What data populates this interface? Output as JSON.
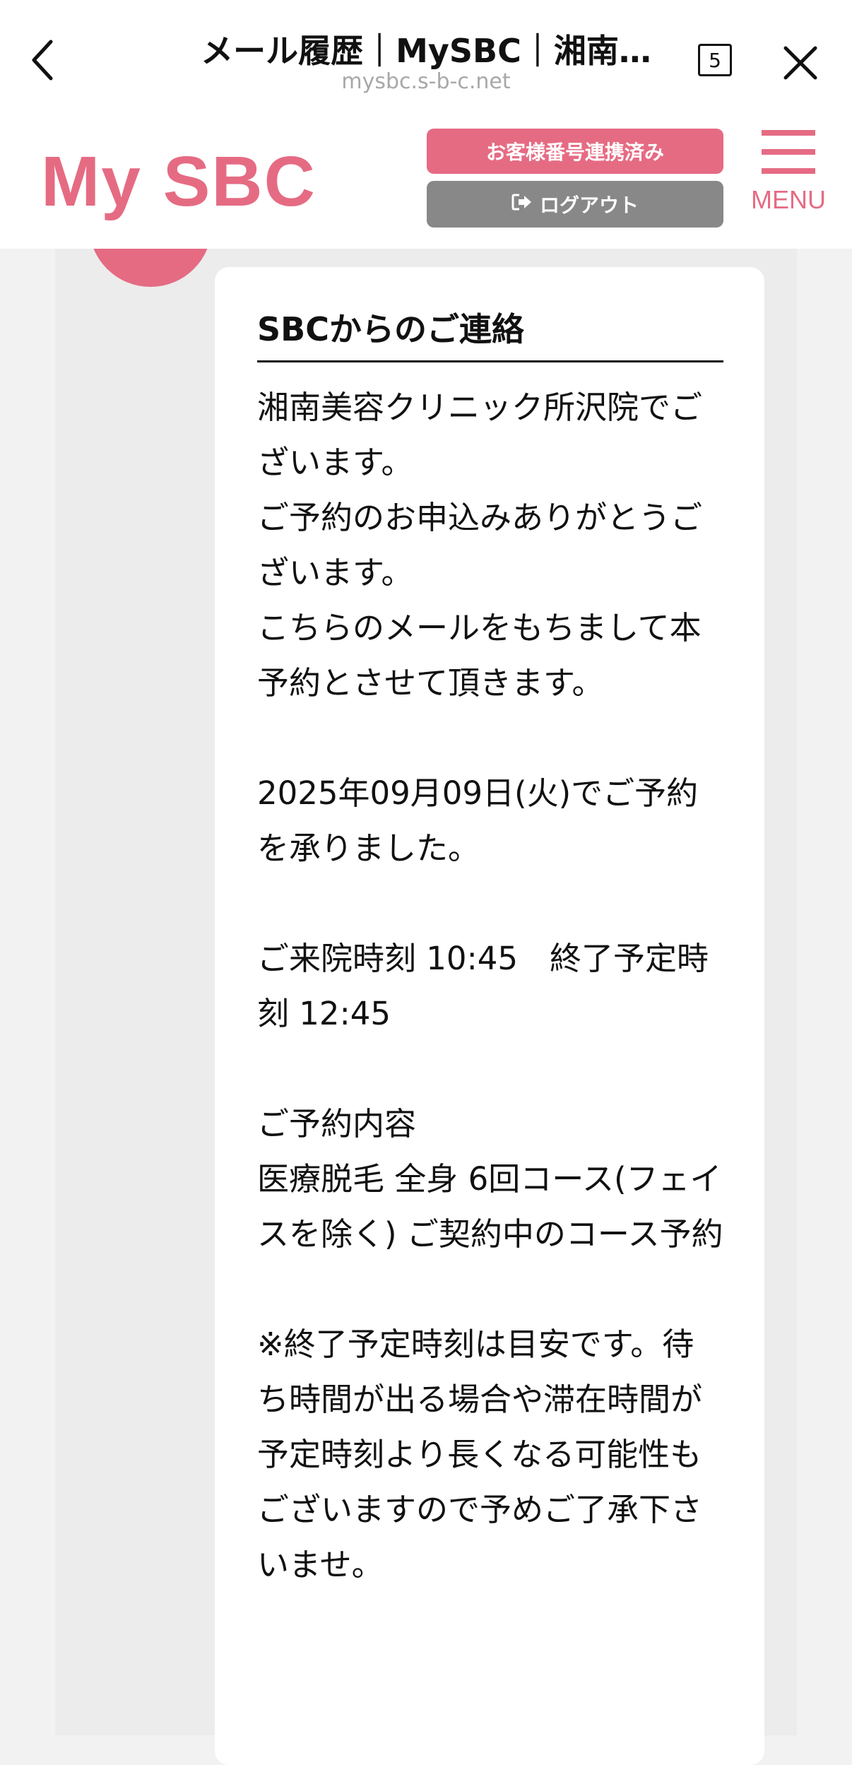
{
  "browser": {
    "title": "メール履歴｜MySBC｜湘南…",
    "url": "mysbc.s-b-c.net",
    "tab_count": "5",
    "back_icon": "chevron-left-icon",
    "close_icon": "close-icon"
  },
  "header": {
    "logo": "My SBC",
    "linked_button": "お客様番号連携済み",
    "logout_button": "ログアウト",
    "logout_icon": "sign-out-icon",
    "menu_label": "MENU",
    "accent_color": "#e56b83"
  },
  "message": {
    "heading": "SBCからのご連絡",
    "body": "湘南美容クリニック所沢院でございます。\nご予約のお申込みありがとうございます。\nこちらのメールをもちまして本予約とさせて頂きます。\n\n2025年09月09日(火)でご予約を承りました。\n\nご来院時刻 10:45　終了予定時刻 12:45\n\nご予約内容\n医療脱毛 全身 6回コース(フェイスを除く) ご契約中のコース予約\n\n※終了予定時刻は目安です。待ち時間が出る場合や滞在時間が予定時刻より長くなる可能性もございますので予めご了承下さいませ。"
  }
}
